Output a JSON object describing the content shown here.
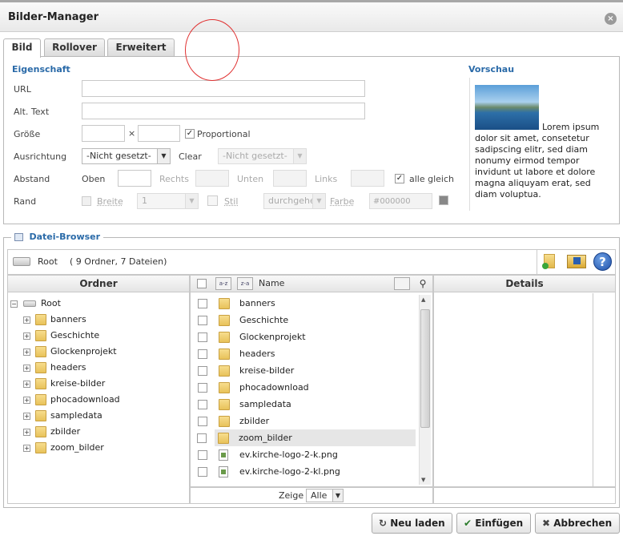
{
  "window": {
    "title": "Bilder-Manager",
    "close_icon": "×"
  },
  "tabs": [
    {
      "label": "Bild"
    },
    {
      "label": "Rollover"
    },
    {
      "label": "Erweitert"
    }
  ],
  "props": {
    "section_title": "Eigenschaft",
    "url_label": "URL",
    "alt_label": "Alt. Text",
    "size_label": "Größe",
    "size_x": "×",
    "proportional_label": "Proportional",
    "proportional_checked": true,
    "align_label": "Ausrichtung",
    "align_value": "-Nicht gesetzt-",
    "clear_label": "Clear",
    "clear_value": "-Nicht gesetzt-",
    "spacing_label": "Abstand",
    "top_label": "Oben",
    "right_label": "Rechts",
    "bottom_label": "Unten",
    "left_label": "Links",
    "all_same_label": "alle gleich",
    "all_same_checked": true,
    "border_label": "Rand",
    "width_label": "Breite",
    "width_value": "1",
    "style_label": "Stil",
    "style_value": "durchgehe",
    "color_label": "Farbe",
    "color_value": "#000000"
  },
  "preview": {
    "title": "Vorschau",
    "text": "Lorem ipsum dolor sit amet, consetetur sadipscing elitr, sed diam nonumy eirmod tempor invidunt ut labore et dolore magna aliquyam erat, sed diam voluptua."
  },
  "browser": {
    "legend": "Datei-Browser",
    "root_label": "Root",
    "summary": "( 9 Ordner, 7 Dateien)",
    "folders_header": "Ordner",
    "name_header": "Name",
    "details_header": "Details",
    "show_label": "Zeige",
    "show_value": "Alle",
    "tree": [
      "banners",
      "Geschichte",
      "Glockenprojekt",
      "headers",
      "kreise-bilder",
      "phocadownload",
      "sampledata",
      "zbilder",
      "zoom_bilder"
    ],
    "files": [
      {
        "name": "banners",
        "type": "folder"
      },
      {
        "name": "Geschichte",
        "type": "folder"
      },
      {
        "name": "Glockenprojekt",
        "type": "folder"
      },
      {
        "name": "headers",
        "type": "folder"
      },
      {
        "name": "kreise-bilder",
        "type": "folder"
      },
      {
        "name": "phocadownload",
        "type": "folder"
      },
      {
        "name": "sampledata",
        "type": "folder"
      },
      {
        "name": "zbilder",
        "type": "folder"
      },
      {
        "name": "zoom_bilder",
        "type": "folder",
        "selected": true
      },
      {
        "name": "ev.kirche-logo-2-k.png",
        "type": "image"
      },
      {
        "name": "ev.kirche-logo-2-kl.png",
        "type": "image"
      }
    ]
  },
  "buttons": {
    "reload": "Neu laden",
    "insert": "Einfügen",
    "cancel": "Abbrechen"
  },
  "colors": {
    "accent": "#2a6aa8",
    "annotation": "#e03030"
  }
}
